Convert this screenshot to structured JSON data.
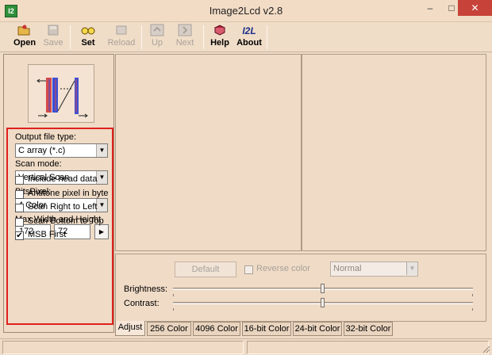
{
  "window": {
    "title": "Image2Lcd v2.8",
    "app_icon_text": "I2",
    "minimize": "–",
    "maximize": "□",
    "close": "✕"
  },
  "toolbar": {
    "open": "Open",
    "save": "Save",
    "set": "Set",
    "reload": "Reload",
    "up": "Up",
    "next": "Next",
    "help": "Help",
    "about": "About",
    "about_icon_text": "I2L"
  },
  "settings": {
    "output_label": "Output file type:",
    "output_value": "C array (*.c)",
    "scan_label": "Scan mode:",
    "scan_value": "Vertical Scan",
    "bits_label": "BitsPixel:",
    "bits_value": "4 Color",
    "size_label": "Max Width and Height",
    "width": "172",
    "height": "72",
    "checkboxes": [
      {
        "label": "Include head data",
        "checked": false
      },
      {
        "label": "Antitone pixel in byte",
        "checked": false
      },
      {
        "label": "Scan Right to Left",
        "checked": false
      },
      {
        "label": "Scan Bottom to Top",
        "checked": false
      },
      {
        "label": "MSB First",
        "checked": true
      }
    ]
  },
  "adjust": {
    "default_label": "Default",
    "reverse_label": "Reverse color",
    "mode_value": "Normal",
    "brightness_label": "Brightness:",
    "contrast_label": "Contrast:",
    "brightness_level": 0.5,
    "contrast_level": 0.5
  },
  "tabs": [
    "Adjust",
    "256 Color",
    "4096 Color",
    "16-bit Color",
    "24-bit Color",
    "32-bit Color"
  ],
  "colors": {
    "accent_red": "#e0201d",
    "panel_bg": "#efdbc6"
  }
}
